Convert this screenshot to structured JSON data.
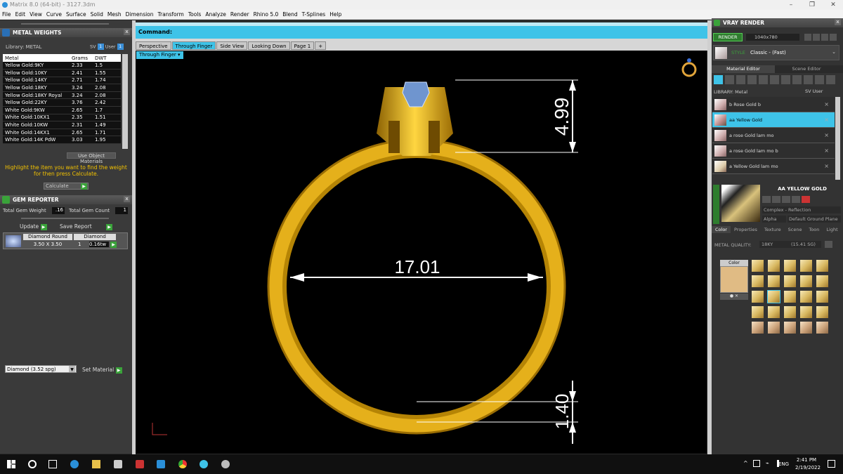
{
  "window": {
    "title": "Matrix 8.0 (64-bit) - 3127.3dm",
    "min": "–",
    "max": "❐",
    "close": "✕"
  },
  "menu": [
    "File",
    "Edit",
    "View",
    "Curve",
    "Surface",
    "Solid",
    "Mesh",
    "Dimension",
    "Transform",
    "Tools",
    "Analyze",
    "Render",
    "Rhino 5.0",
    "Blend",
    "T-Splines",
    "Help"
  ],
  "metal_weights": {
    "title": "METAL WEIGHTS",
    "library": "Library: METAL",
    "sv": "SV",
    "user": "User",
    "headers": [
      "Metal",
      "Grams",
      "DWT"
    ],
    "rows": [
      [
        "Yellow Gold:9KY",
        "2.33",
        "1.5"
      ],
      [
        "Yellow Gold:10KY",
        "2.41",
        "1.55"
      ],
      [
        "Yellow Gold:14KY",
        "2.71",
        "1.74"
      ],
      [
        "Yellow Gold:18KY",
        "3.24",
        "2.08"
      ],
      [
        "Yellow Gold:18KY Royal",
        "3.24",
        "2.08"
      ],
      [
        "Yellow Gold:22KY",
        "3.76",
        "2.42"
      ],
      [
        "White Gold:9KW",
        "2.65",
        "1.7"
      ],
      [
        "White Gold:10KX1",
        "2.35",
        "1.51"
      ],
      [
        "White Gold:10KW",
        "2.31",
        "1.49"
      ],
      [
        "White Gold:14KX1",
        "2.65",
        "1.71"
      ],
      [
        "White Gold:14K PdW",
        "3.03",
        "1.95"
      ]
    ],
    "use_object_materials": "Use Object Materials",
    "hint": "Highlight the item you want to find the weight for then press Calculate.",
    "calculate": "Calculate"
  },
  "gem_reporter": {
    "title": "GEM REPORTER",
    "total_weight_label": "Total Gem Weight",
    "total_weight": ".16",
    "total_count_label": "Total Gem Count",
    "total_count": "1",
    "update": "Update",
    "save_report": "Save Report",
    "gem": {
      "name": "Diamond Round",
      "size": "3.50 X 3.50",
      "type": "Diamond",
      "count": "1",
      "weight": "0.16tw"
    }
  },
  "material_select": {
    "value": "Diamond    (3.52 spg)",
    "set_label": "Set Material"
  },
  "command": {
    "label": "Command:"
  },
  "view_tabs": [
    "Perspective",
    "Through Finger",
    "Side View",
    "Looking Down",
    "Page 1",
    "+"
  ],
  "active_view": "Through Finger",
  "dimensions": {
    "top": "4.99",
    "width": "17.01",
    "bottom": "1.40"
  },
  "vray": {
    "title": "VRAY RENDER",
    "render": "RENDER",
    "resolution": "1040x780",
    "style_label": "STYLE",
    "style": "Classic - (Fast)",
    "tabs": [
      "Material Editor",
      "Scene Editor"
    ],
    "library": "LIBRARY: Metal",
    "sv": "SV",
    "user": "User",
    "items": [
      "b Rose Gold b",
      "aa Yellow Gold",
      "a rose Gold lam mo",
      "a rose Gold lam mo b",
      "a Yellow Gold lam mo"
    ],
    "selected_material": "AA YELLOW GOLD",
    "complex": "Complex - Reflection",
    "alpha": "Alpha",
    "ground": "Default Ground Plane",
    "prop_tabs": [
      "Color",
      "Properties",
      "Texture",
      "Scene",
      "Toon",
      "Light"
    ],
    "metal_quality_label": "METAL QUALITY:",
    "metal_quality": "18KY",
    "metal_quality_val": "(15.41 SG)",
    "color_label": "Color"
  },
  "taskbar": {
    "lang": "ENG",
    "time": "2:41 PM",
    "date": "2/19/2022"
  },
  "colors": {
    "accent": "#3ec3e8",
    "gold": "#e8b21a",
    "green": "#3aa33a"
  }
}
